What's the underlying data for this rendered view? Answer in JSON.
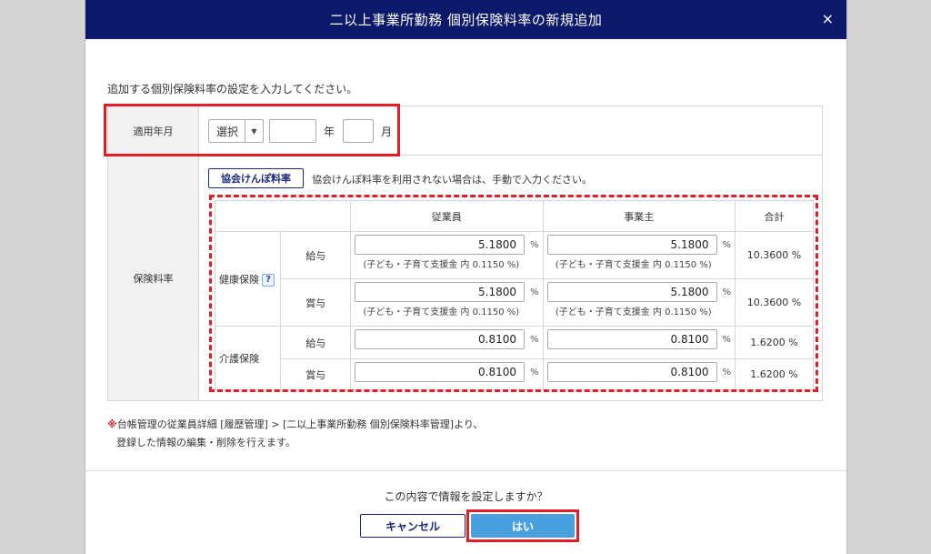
{
  "dialog": {
    "title": "二以上事業所勤務 個別保険料率の新規追加",
    "close_icon": "×",
    "intro": "追加する個別保険料率の設定を入力してください。"
  },
  "date_row": {
    "label": "適用年月",
    "select_value": "選択",
    "year_label": "年",
    "month_label": "月"
  },
  "rate_row": {
    "label": "保険料率",
    "kyokai_button": "協会けんぽ料率",
    "kyokai_note": "協会けんぽ料率を利用されない場合は、手動で入力ください。",
    "columns": [
      "従業員",
      "事業主",
      "合計"
    ],
    "groups": [
      {
        "name": "健康保険",
        "help": "?",
        "rows": [
          {
            "type": "給与",
            "employee": "5.1800",
            "employee_note": "(子ども・子育て支援金 内 0.1150 %)",
            "employer": "5.1800",
            "employer_note": "(子ども・子育て支援金 内 0.1150 %)",
            "total": "10.3600 %"
          },
          {
            "type": "賞与",
            "employee": "5.1800",
            "employee_note": "(子ども・子育て支援金 内 0.1150 %)",
            "employer": "5.1800",
            "employer_note": "(子ども・子育て支援金 内 0.1150 %)",
            "total": "10.3600 %"
          }
        ]
      },
      {
        "name": "介護保険",
        "rows": [
          {
            "type": "給与",
            "employee": "0.8100",
            "employer": "0.8100",
            "total": "1.6200 %"
          },
          {
            "type": "賞与",
            "employee": "0.8100",
            "employer": "0.8100",
            "total": "1.6200 %"
          }
        ]
      }
    ],
    "pct": "%"
  },
  "notes": {
    "mark": "※",
    "line1": "台帳管理の従業員詳細 [履歴管理] > [二以上事業所勤務 個別保険料率管理]より、",
    "line2": "登録した情報の編集・削除を行えます。"
  },
  "footer": {
    "confirm": "この内容で情報を設定しますか？",
    "cancel": "キャンセル",
    "ok": "はい"
  },
  "colors": {
    "header": "#0d1a6b",
    "highlight": "#e41e26",
    "primary": "#4a9fde"
  }
}
